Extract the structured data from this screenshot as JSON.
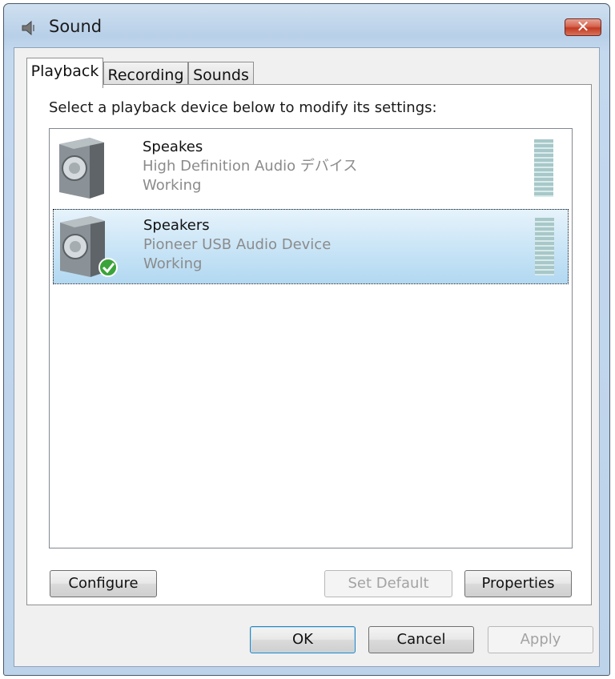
{
  "window": {
    "title": "Sound",
    "close_label": "✕"
  },
  "tabs": [
    {
      "label": "Playback",
      "active": true
    },
    {
      "label": "Recording",
      "active": false
    },
    {
      "label": "Sounds",
      "active": false
    }
  ],
  "playback": {
    "instruction": "Select a playback device below to modify its settings:",
    "devices": [
      {
        "name": "Speakes",
        "description": "High Definition Audio デバイス",
        "status": "Working",
        "selected": false,
        "is_default": false
      },
      {
        "name": "Speakers",
        "description": "Pioneer USB Audio Device",
        "status": "Working",
        "selected": true,
        "is_default": true
      }
    ],
    "buttons": {
      "configure": "Configure",
      "set_default": "Set Default",
      "properties": "Properties"
    }
  },
  "footer": {
    "ok": "OK",
    "cancel": "Cancel",
    "apply": "Apply"
  },
  "colors": {
    "selection": "#c8e4f6",
    "close_button": "#c23b22",
    "default_check": "#3aa33a"
  },
  "icons": {
    "app": "speaker-icon",
    "device": "speaker-cabinet-icon",
    "default_badge": "checkmark-icon"
  }
}
